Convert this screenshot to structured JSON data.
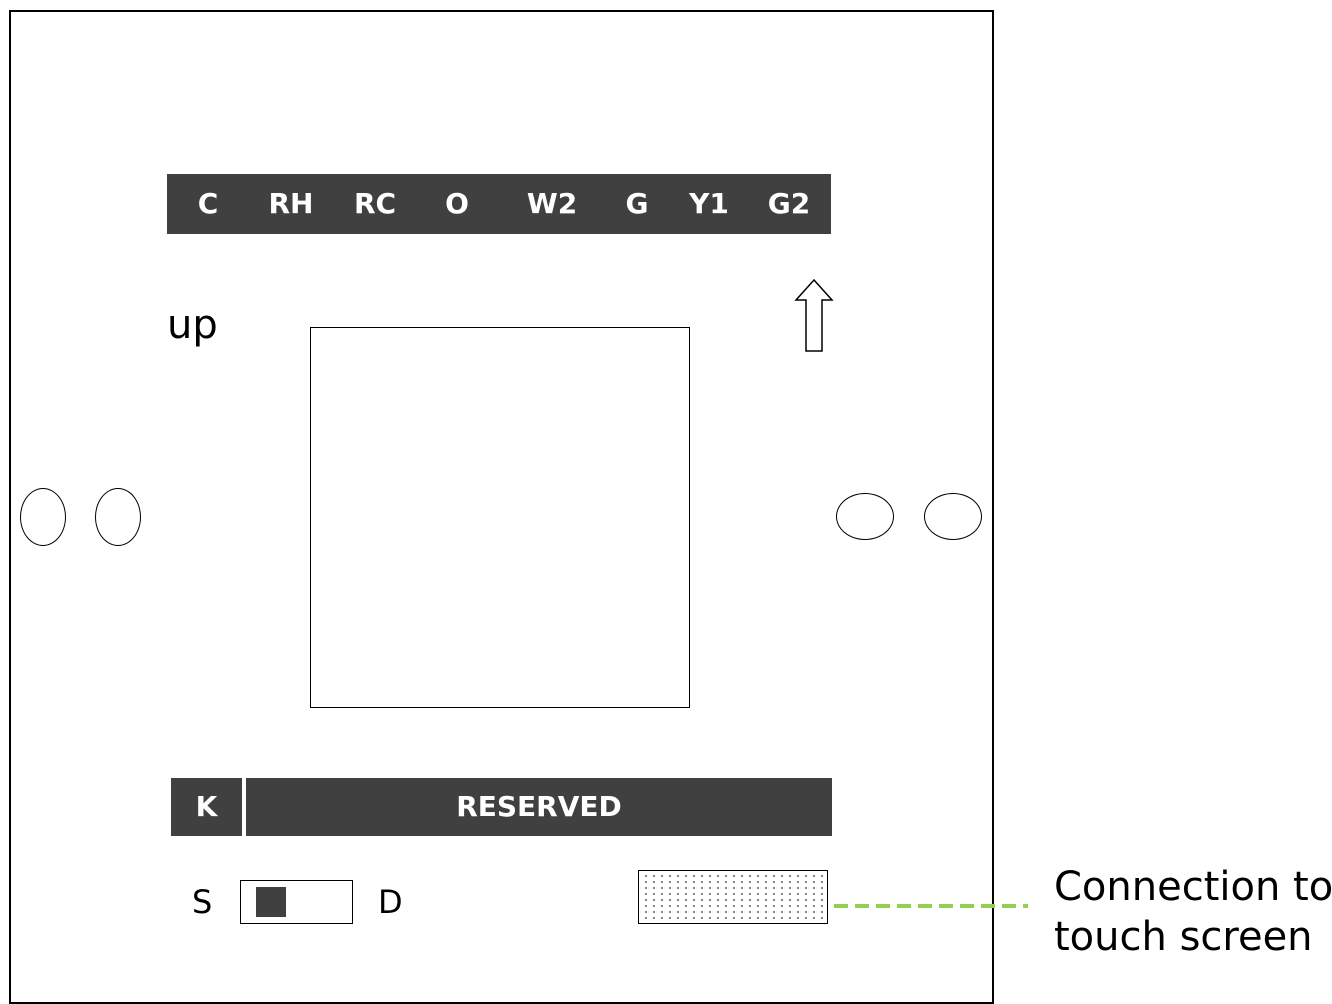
{
  "top_terminals": [
    "C",
    "RH",
    "RC",
    "O",
    "W2",
    "G",
    "Y1",
    "G2"
  ],
  "up_label": "up",
  "bottom_bar": {
    "left_label": "K",
    "main_label": "RESERVED"
  },
  "switch": {
    "left_label": "S",
    "right_label": "D"
  },
  "connector_label": {
    "line1": "Connection to",
    "line2": "touch screen"
  },
  "colors": {
    "bar": "#404040",
    "leader": "#92d050"
  },
  "icons": {
    "arrow": "up-arrow-icon"
  }
}
